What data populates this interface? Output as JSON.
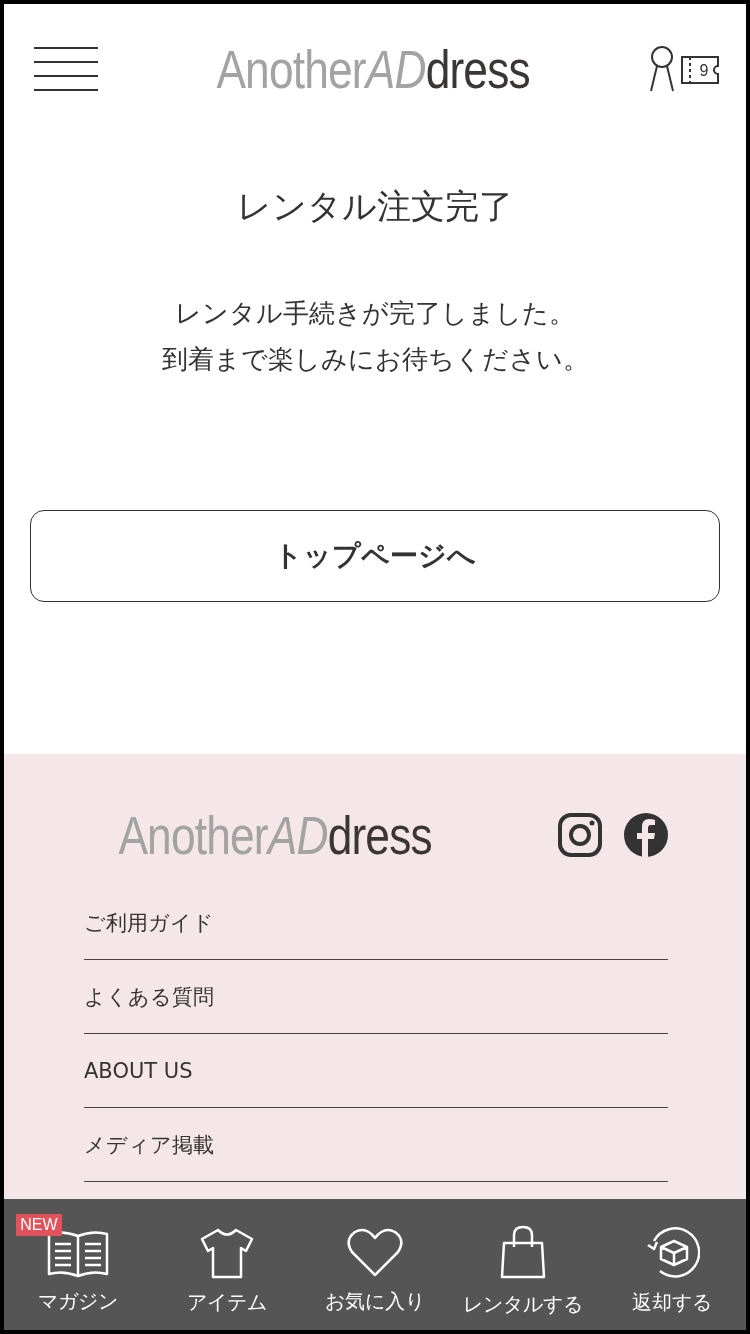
{
  "header": {
    "logo": {
      "part_1": "Another",
      "part_2": "AD",
      "part_3": "dress"
    },
    "ticket_count": "9"
  },
  "title": "レンタル注文完了",
  "message": [
    "レンタル手続きが完了しました。",
    "到着まで楽しみにお待ちください。"
  ],
  "top_button": "トップページへ",
  "footer": {
    "logo": {
      "part_1": "Another",
      "part_2": "AD",
      "part_3": "dress"
    },
    "links": [
      "ご利用ガイド",
      "よくある質問",
      "ABOUT US",
      "メディア掲載"
    ]
  },
  "bottom_nav": [
    {
      "kind": "magazine",
      "label": "マガジン",
      "badge": "NEW"
    },
    {
      "kind": "item",
      "label": "アイテム"
    },
    {
      "kind": "favorite",
      "label": "お気に入り"
    },
    {
      "kind": "rental",
      "label": "レンタルする"
    },
    {
      "kind": "return",
      "label": "返却する"
    }
  ]
}
